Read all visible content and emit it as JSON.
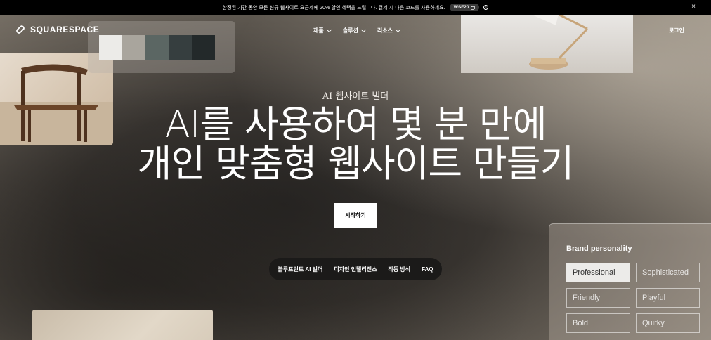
{
  "announcement": {
    "text": "한정된 기간 동안 모든 신규 웹사이트 요금제에 20% 할인 혜택을 드립니다. 결제 시 다음 코드를 사용하세요.",
    "promo_code": "WSF20",
    "copy_icon": "copy-icon",
    "info_icon": "info-icon",
    "close_icon": "close-icon"
  },
  "header": {
    "logo_text": "SQUARESPACE",
    "nav": [
      {
        "label": "제품"
      },
      {
        "label": "솔루션"
      },
      {
        "label": "리소스"
      }
    ],
    "login_label": "로그인"
  },
  "swatches": [
    "#ecebe8",
    "#a9a59d",
    "#5b6663",
    "#363e3f",
    "#23292a"
  ],
  "hero": {
    "eyebrow": "AI 웹사이트 빌더",
    "title_line1": "AI를 사용하여 몇 분 만에",
    "title_line2": "개인 맞춤형 웹사이트 만들기",
    "cta_label": "시작하기"
  },
  "subnav": [
    {
      "label": "블루프린트 AI 빌더"
    },
    {
      "label": "디자인 인텔리전스"
    },
    {
      "label": "작동 방식"
    },
    {
      "label": "FAQ"
    }
  ],
  "brand_personality": {
    "title": "Brand personality",
    "options": [
      {
        "label": "Professional",
        "selected": true
      },
      {
        "label": "Sophisticated",
        "selected": false
      },
      {
        "label": "Friendly",
        "selected": false
      },
      {
        "label": "Playful",
        "selected": false
      },
      {
        "label": "Bold",
        "selected": false
      },
      {
        "label": "Quirky",
        "selected": false
      }
    ]
  }
}
